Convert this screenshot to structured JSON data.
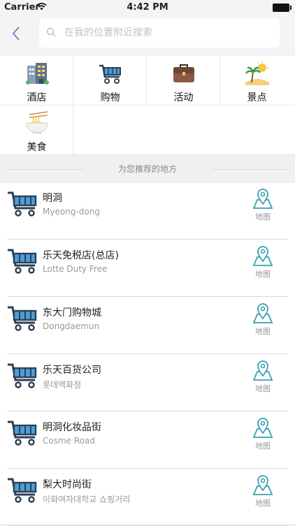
{
  "status_bar": {
    "carrier": "Carrier",
    "time": "4:42 PM"
  },
  "search": {
    "placeholder": "在我的位置附近搜索"
  },
  "categories": [
    {
      "label": "酒店",
      "icon": "hotel-icon"
    },
    {
      "label": "购物",
      "icon": "shopping-cart-icon"
    },
    {
      "label": "活动",
      "icon": "briefcase-icon"
    },
    {
      "label": "景点",
      "icon": "beach-icon"
    },
    {
      "label": "美食",
      "icon": "noodle-bowl-icon"
    }
  ],
  "section_title": "为您推荐的地方",
  "places": [
    {
      "name": "明洞",
      "subtitle": "Myeong-dong",
      "map_label": "地图"
    },
    {
      "name": "乐天免税店(总店)",
      "subtitle": "Lotte Duty Free",
      "map_label": "地图"
    },
    {
      "name": "东大门购物城",
      "subtitle": "Dongdaemun",
      "map_label": "地图"
    },
    {
      "name": "乐天百货公司",
      "subtitle": "롯데백화점",
      "map_label": "地图"
    },
    {
      "name": "明洞化妆品街",
      "subtitle": "Cosme Road",
      "map_label": "地图"
    },
    {
      "name": "梨大时尚街",
      "subtitle": "이화여자대학교 쇼핑거리",
      "map_label": "地图"
    }
  ],
  "colors": {
    "accent": "#3aa0b4",
    "cart_blue": "#4a9fd8",
    "cart_dark": "#2e3f55"
  }
}
